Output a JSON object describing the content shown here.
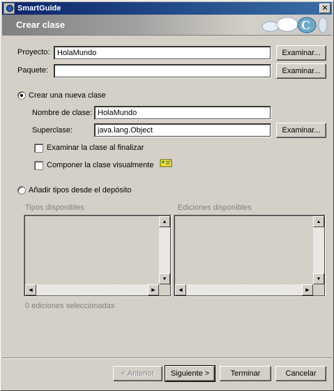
{
  "window": {
    "title": "SmartGuide",
    "close_glyph": "✕"
  },
  "banner": {
    "title": "Crear clase",
    "logo_icon": "smartguide-logo-icon"
  },
  "project": {
    "label": "Proyecto:",
    "value": "HolaMundo",
    "browse": "Examinar..."
  },
  "package": {
    "label": "Paquete:",
    "value": "",
    "browse": "Examinar..."
  },
  "new_class": {
    "radio_label": "Crear una nueva clase",
    "checked": true,
    "class_name_label": "Nombre de clase:",
    "class_name_value": "HolaMundo",
    "superclass_label": "Superclase:",
    "superclass_value": "java.lang.Object",
    "browse": "Examinar...",
    "browse_on_finish_label": "Examinar la clase al finalizar",
    "compose_visually_label": "Componer la clase visualmente"
  },
  "add_types": {
    "radio_label": "Añadir tipos desde el depósito",
    "checked": false,
    "available_types_label": "Tipos disponibles",
    "available_editions_label": "Ediciones disponibles",
    "selected_count_text": "0 ediciones seleccionadas"
  },
  "footer": {
    "back": "< Anterior",
    "next": "Siguiente >",
    "finish": "Terminar",
    "cancel": "Cancelar"
  },
  "colors": {
    "titlebar_start": "#0a246a",
    "titlebar_end": "#3a6ea5",
    "face": "#d4d0c8",
    "disabled_text": "#808080"
  }
}
